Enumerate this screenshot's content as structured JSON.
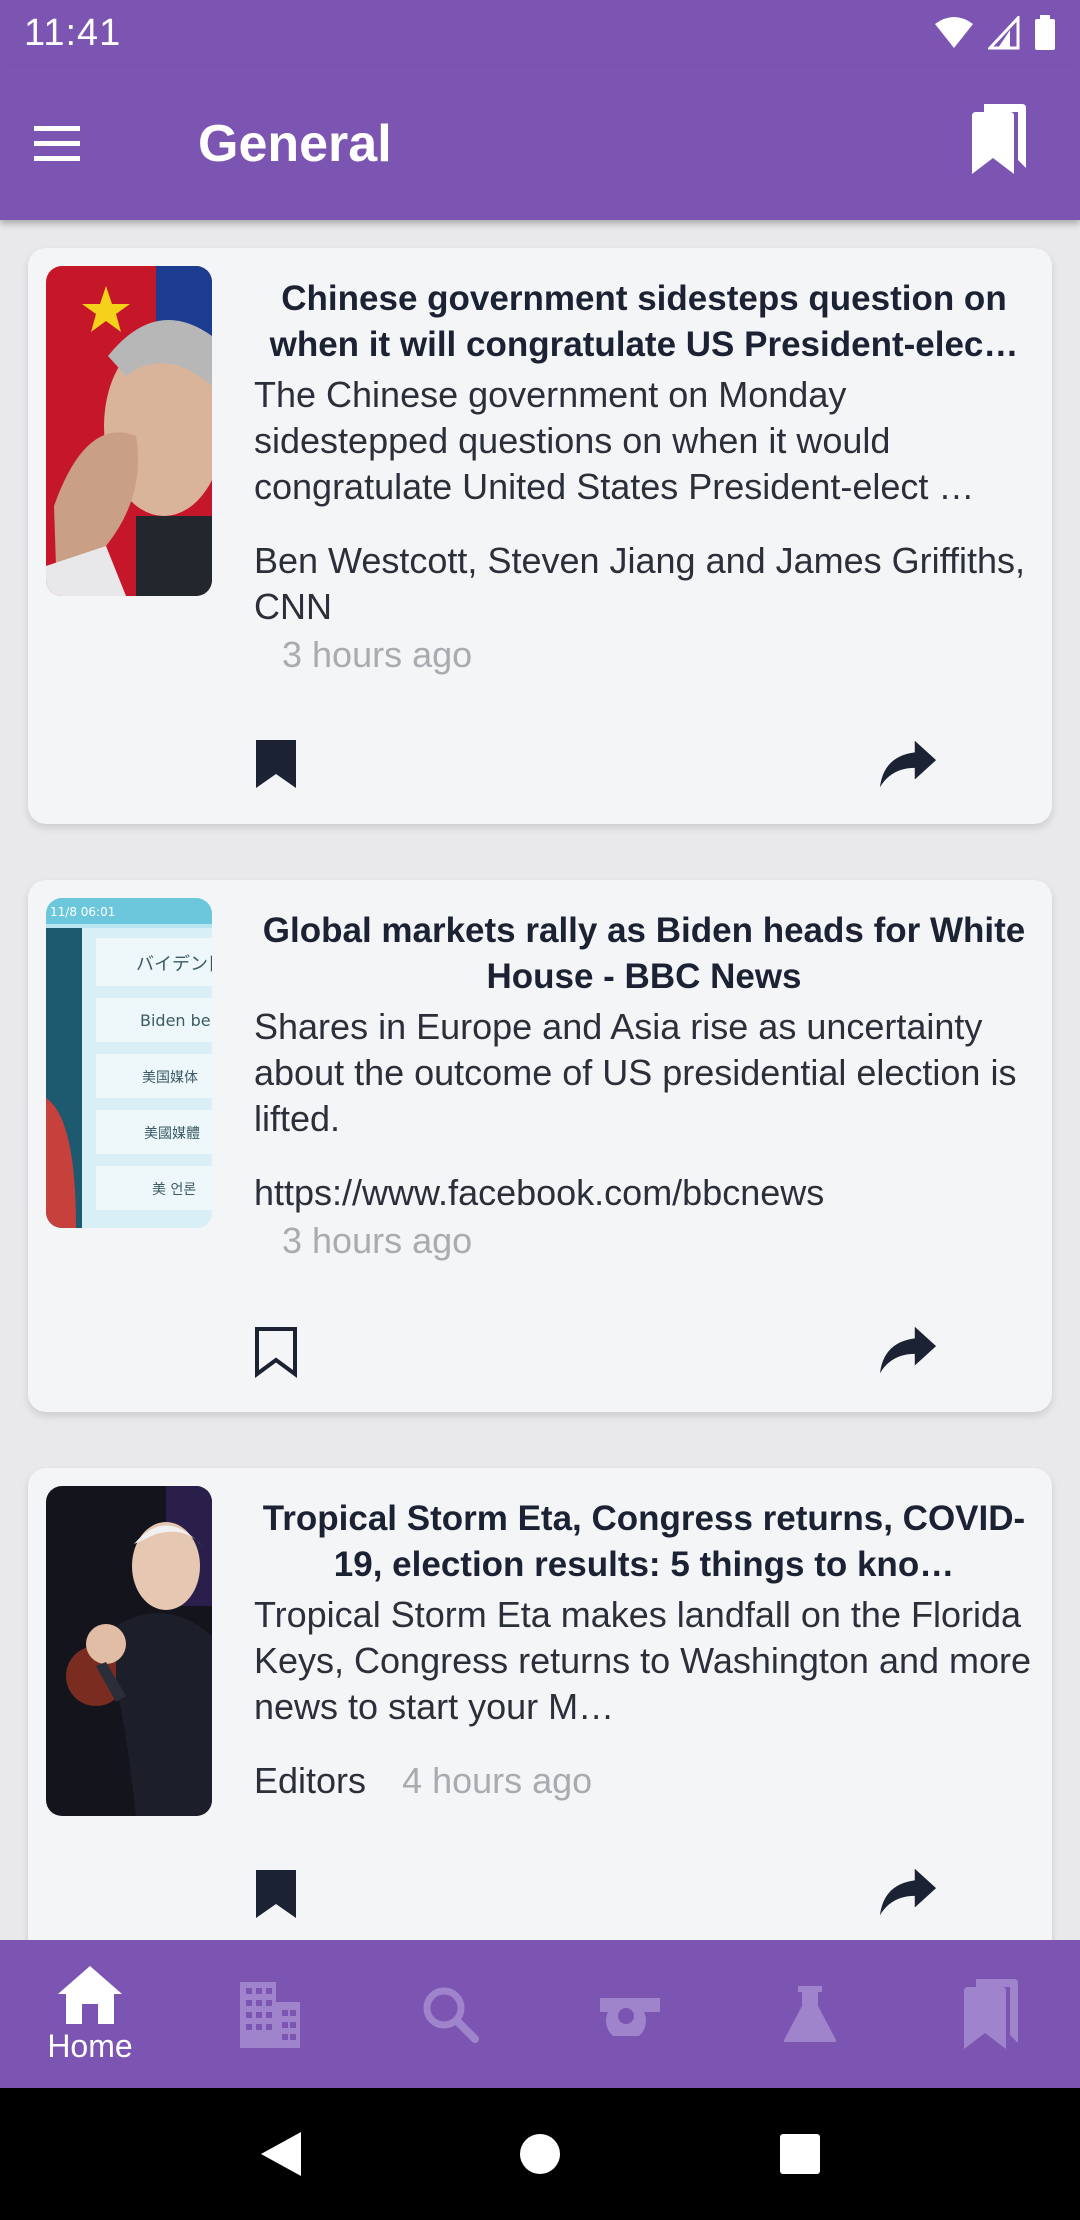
{
  "status_bar": {
    "time": "11:41"
  },
  "app_bar": {
    "title": "General",
    "menu_icon": "hamburger-menu-icon",
    "bookmarks_icon": "bookmarks-icon"
  },
  "colors": {
    "brand": "#7c55b3",
    "card_bg": "#f4f5f7",
    "headline": "#1b2233",
    "muted": "#a9abb0"
  },
  "articles": [
    {
      "headline": "Chinese government sidesteps question on when it will congratulate US President-elec…",
      "description": "The Chinese government on Monday sidestepped questions on when it would congratulate United States President-elect …",
      "author": "Ben Westcott, Steven Jiang and James Griffiths, CNN",
      "time": "3 hours ago",
      "bookmarked": true
    },
    {
      "headline": "Global markets rally as Biden heads for White House - BBC News",
      "description": "Shares in Europe and Asia rise as uncertainty about the outcome of US presidential election is lifted.",
      "author": "https://www.facebook.com/bbcnews",
      "time": "3 hours ago",
      "bookmarked": false,
      "thumb_text": [
        "11/8 06:01",
        "バイデン目",
        "Biden be",
        "美国媒体",
        "美國媒體",
        "美 언론"
      ]
    },
    {
      "headline": "Tropical Storm Eta, Congress returns, COVID-19, election results: 5 things to kno…",
      "description": "Tropical Storm Eta makes landfall on the Florida Keys, Congress returns to Washington and more news to start your M…",
      "author": "Editors",
      "time": "4 hours ago",
      "bookmarked": true
    }
  ],
  "bottom_nav": [
    {
      "label": "Home",
      "icon": "home-icon",
      "active": true
    },
    {
      "label": "",
      "icon": "business-icon",
      "active": false
    },
    {
      "label": "",
      "icon": "search-icon",
      "active": false
    },
    {
      "label": "",
      "icon": "whistle-icon",
      "active": false
    },
    {
      "label": "",
      "icon": "flask-icon",
      "active": false
    },
    {
      "label": "",
      "icon": "bookmarks-icon",
      "active": false
    }
  ]
}
